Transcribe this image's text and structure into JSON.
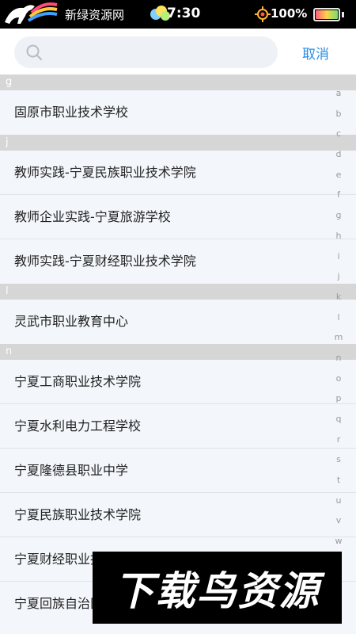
{
  "status_bar": {
    "carrier": "新绿资源网",
    "time": "7:30",
    "battery_percent": "100%",
    "battery_level": 1.0,
    "icons": [
      "horse-logo-icon",
      "balloons-icon",
      "gps-icon",
      "battery-icon"
    ]
  },
  "search": {
    "placeholder": "",
    "value": "",
    "cancel_label": "取消",
    "accent_color": "#2a8ee8"
  },
  "sections": [
    {
      "letter": "g",
      "items": [
        "固原市职业技术学校"
      ]
    },
    {
      "letter": "j",
      "items": [
        "教师实践-宁夏民族职业技术学院",
        "教师企业实践-宁夏旅游学校",
        "教师实践-宁夏财经职业技术学院"
      ]
    },
    {
      "letter": "l",
      "items": [
        "灵武市职业教育中心"
      ]
    },
    {
      "letter": "n",
      "items": [
        "宁夏工商职业技术学院",
        "宁夏水利电力工程学校",
        "宁夏隆德县职业中学",
        "宁夏民族职业技术学院",
        "宁夏财经职业技术学院",
        "宁夏回族自治区"
      ]
    }
  ],
  "alpha_index": [
    "a",
    "b",
    "c",
    "d",
    "e",
    "f",
    "g",
    "h",
    "i",
    "j",
    "k",
    "l",
    "m",
    "n",
    "o",
    "p",
    "q",
    "r",
    "s",
    "t",
    "u",
    "v",
    "w"
  ],
  "watermark": {
    "text": "下载鸟资源"
  }
}
